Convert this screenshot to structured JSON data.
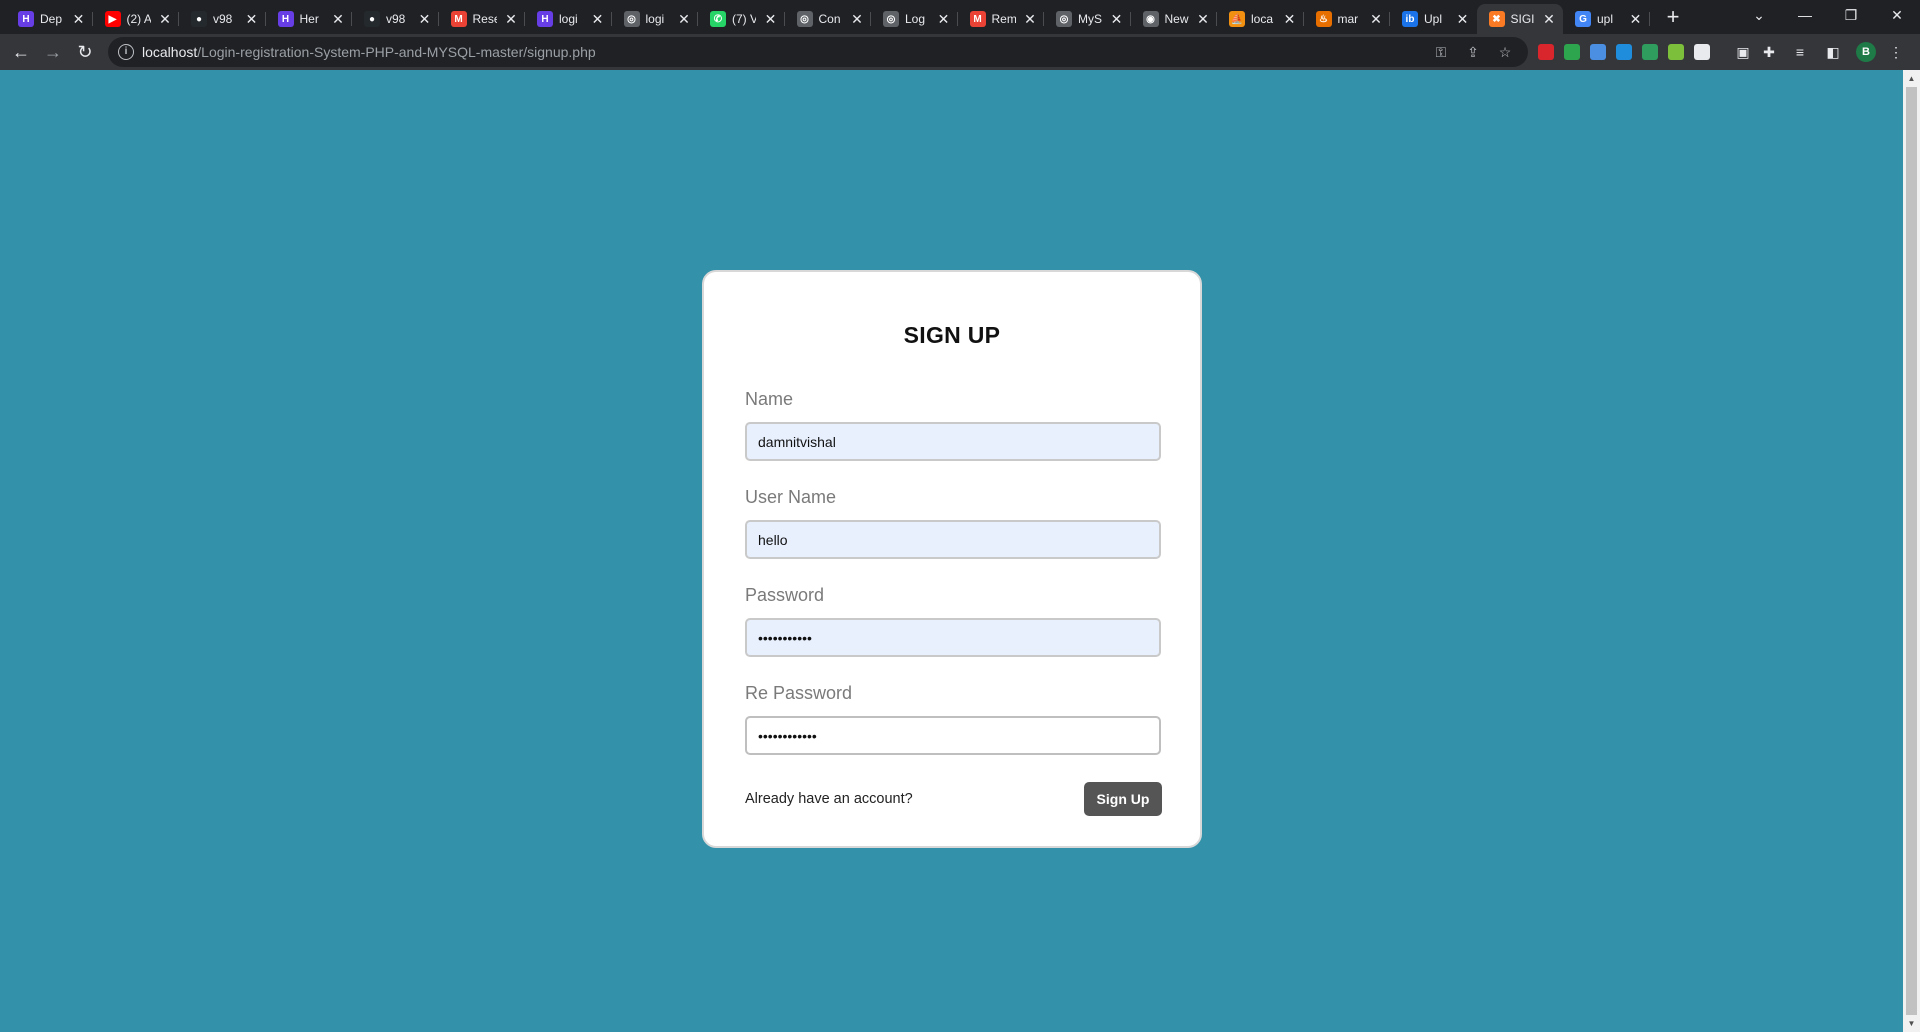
{
  "browser": {
    "tabs": [
      {
        "title": "Dep",
        "icon": "hostinger-icon",
        "color": "#673de6",
        "glyph": "H"
      },
      {
        "title": "(2) A",
        "icon": "youtube-icon",
        "color": "#ff0000",
        "glyph": "▶"
      },
      {
        "title": "v98",
        "icon": "github-icon",
        "color": "#24292e",
        "glyph": "●"
      },
      {
        "title": "Her",
        "icon": "hostinger-icon",
        "color": "#673de6",
        "glyph": "H"
      },
      {
        "title": "v98",
        "icon": "github-icon",
        "color": "#24292e",
        "glyph": "●"
      },
      {
        "title": "Rese",
        "icon": "gmail-icon",
        "color": "#ea4335",
        "glyph": "M"
      },
      {
        "title": "logi",
        "icon": "hostinger-icon",
        "color": "#673de6",
        "glyph": "H"
      },
      {
        "title": "logi",
        "icon": "globe-icon",
        "color": "#5f6368",
        "glyph": "◎"
      },
      {
        "title": "(7) V",
        "icon": "whatsapp-icon",
        "color": "#25d366",
        "glyph": "✆"
      },
      {
        "title": "Con",
        "icon": "globe-icon",
        "color": "#5f6368",
        "glyph": "◎"
      },
      {
        "title": "Log",
        "icon": "globe-icon",
        "color": "#5f6368",
        "glyph": "◎"
      },
      {
        "title": "Rem",
        "icon": "gmail-icon",
        "color": "#ea4335",
        "glyph": "M"
      },
      {
        "title": "MyS",
        "icon": "globe-icon",
        "color": "#5f6368",
        "glyph": "◎"
      },
      {
        "title": "New",
        "icon": "chrome-icon",
        "color": "#5f6368",
        "glyph": "◉"
      },
      {
        "title": "loca",
        "icon": "phpmyadmin-icon",
        "color": "#f29111",
        "glyph": "⛵"
      },
      {
        "title": "mar",
        "icon": "java-icon",
        "color": "#e76f00",
        "glyph": "♨"
      },
      {
        "title": "Upl",
        "icon": "upload-site-icon",
        "color": "#1a73e8",
        "glyph": "ib"
      },
      {
        "title": "SIGI",
        "icon": "xampp-icon",
        "color": "#fb7a24",
        "glyph": "✖"
      },
      {
        "title": "upl",
        "icon": "google-icon",
        "color": "#4285f4",
        "glyph": "G"
      }
    ],
    "active_tab": 17,
    "url_host": "localhost",
    "url_path": "/Login-registration-System-PHP-and-MYSQL-master/signup.php",
    "profile_initial": "B",
    "extension_colors": [
      "#d9262c",
      "#2da44e",
      "#4a8fe2",
      "#1f8ddb",
      "#2e9d5d",
      "#7cbf3b",
      "#e8eaed"
    ]
  },
  "page": {
    "background": "#3391a9",
    "form": {
      "title": "SIGN UP",
      "name_label": "Name",
      "name_value": "damnitvishal",
      "username_label": "User Name",
      "username_value": "hello",
      "password_label": "Password",
      "password_value": "hello123456",
      "repassword_label": "Re Password",
      "repassword_value": "hello1234567",
      "already_text": "Already have an account?",
      "submit_label": "Sign Up"
    }
  }
}
